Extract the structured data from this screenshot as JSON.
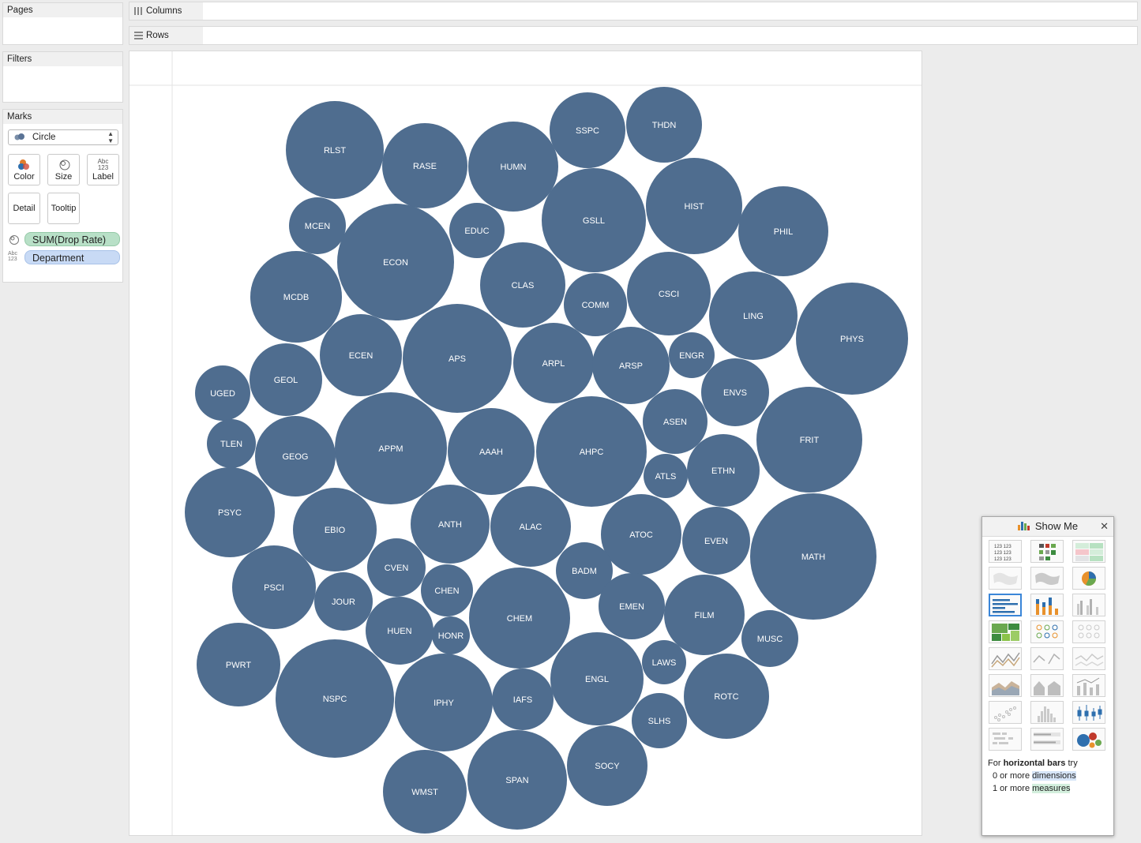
{
  "panels": {
    "pages": "Pages",
    "filters": "Filters",
    "marks": "Marks"
  },
  "marks_card": {
    "mark_type": "Circle",
    "buttons": {
      "color": "Color",
      "size": "Size",
      "label": "Label",
      "detail": "Detail",
      "tooltip": "Tooltip"
    },
    "label_icon_text": "Abc 123",
    "pills": [
      {
        "type": "size",
        "field": "SUM(Drop Rate)"
      },
      {
        "type": "label",
        "field": "Department"
      }
    ]
  },
  "shelves": {
    "columns": "Columns",
    "rows": "Rows"
  },
  "colors": {
    "bubble": "#4f6d8f",
    "measure_pill": "#b8e0c7",
    "dimension_pill": "#c8daf5",
    "selection": "#3a86d8"
  },
  "chart_data": {
    "type": "packed-bubble",
    "size_measure": "SUM(Drop Rate)",
    "label_dimension": "Department",
    "bubbles": [
      {
        "label": "RLST",
        "size": 62
      },
      {
        "label": "RASE",
        "size": 54
      },
      {
        "label": "HUMN",
        "size": 57
      },
      {
        "label": "SSPC",
        "size": 48
      },
      {
        "label": "THDN",
        "size": 48
      },
      {
        "label": "MCEN",
        "size": 36
      },
      {
        "label": "EDUC",
        "size": 35
      },
      {
        "label": "GSLL",
        "size": 66
      },
      {
        "label": "HIST",
        "size": 61
      },
      {
        "label": "PHIL",
        "size": 57
      },
      {
        "label": "ECON",
        "size": 74
      },
      {
        "label": "CLAS",
        "size": 54
      },
      {
        "label": "COMM",
        "size": 40
      },
      {
        "label": "CSCI",
        "size": 53
      },
      {
        "label": "MCDB",
        "size": 58
      },
      {
        "label": "LING",
        "size": 56
      },
      {
        "label": "PHYS",
        "size": 71
      },
      {
        "label": "ECEN",
        "size": 52
      },
      {
        "label": "APS",
        "size": 69
      },
      {
        "label": "ARPL",
        "size": 51
      },
      {
        "label": "ARSP",
        "size": 49
      },
      {
        "label": "ENGR",
        "size": 29
      },
      {
        "label": "UGED",
        "size": 35
      },
      {
        "label": "GEOL",
        "size": 46
      },
      {
        "label": "ENVS",
        "size": 43
      },
      {
        "label": "ASEN",
        "size": 41
      },
      {
        "label": "FRIT",
        "size": 67
      },
      {
        "label": "TLEN",
        "size": 31
      },
      {
        "label": "GEOG",
        "size": 51
      },
      {
        "label": "APPM",
        "size": 71
      },
      {
        "label": "AAAH",
        "size": 55
      },
      {
        "label": "AHPC",
        "size": 70
      },
      {
        "label": "ATLS",
        "size": 28
      },
      {
        "label": "ETHN",
        "size": 46
      },
      {
        "label": "PSYC",
        "size": 57
      },
      {
        "label": "EBIO",
        "size": 53
      },
      {
        "label": "ANTH",
        "size": 50
      },
      {
        "label": "ALAC",
        "size": 51
      },
      {
        "label": "ATOC",
        "size": 51
      },
      {
        "label": "EVEN",
        "size": 43
      },
      {
        "label": "MATH",
        "size": 80
      },
      {
        "label": "CVEN",
        "size": 37
      },
      {
        "label": "BADM",
        "size": 36
      },
      {
        "label": "PSCI",
        "size": 53
      },
      {
        "label": "JOUR",
        "size": 37
      },
      {
        "label": "CHEN",
        "size": 33
      },
      {
        "label": "CHEM",
        "size": 64
      },
      {
        "label": "EMEN",
        "size": 42
      },
      {
        "label": "FILM",
        "size": 51
      },
      {
        "label": "HUEN",
        "size": 43
      },
      {
        "label": "HONR",
        "size": 24
      },
      {
        "label": "LAWS",
        "size": 28
      },
      {
        "label": "MUSC",
        "size": 36
      },
      {
        "label": "PWRT",
        "size": 53
      },
      {
        "label": "NSPC",
        "size": 75
      },
      {
        "label": "IPHY",
        "size": 62
      },
      {
        "label": "IAFS",
        "size": 39
      },
      {
        "label": "ENGL",
        "size": 59
      },
      {
        "label": "ROTC",
        "size": 54
      },
      {
        "label": "SLHS",
        "size": 35
      },
      {
        "label": "SOCY",
        "size": 51
      },
      {
        "label": "SPAN",
        "size": 63
      },
      {
        "label": "WMST",
        "size": 53
      }
    ]
  },
  "show_me": {
    "title": "Show Me",
    "selected": "horizontal bars",
    "hint_prefix": "For",
    "hint_chart": "horizontal bars",
    "hint_suffix": "try",
    "req_dims_count": "0 or more",
    "req_dims": "dimensions",
    "req_meas_count": "1 or more",
    "req_meas": "measures"
  }
}
